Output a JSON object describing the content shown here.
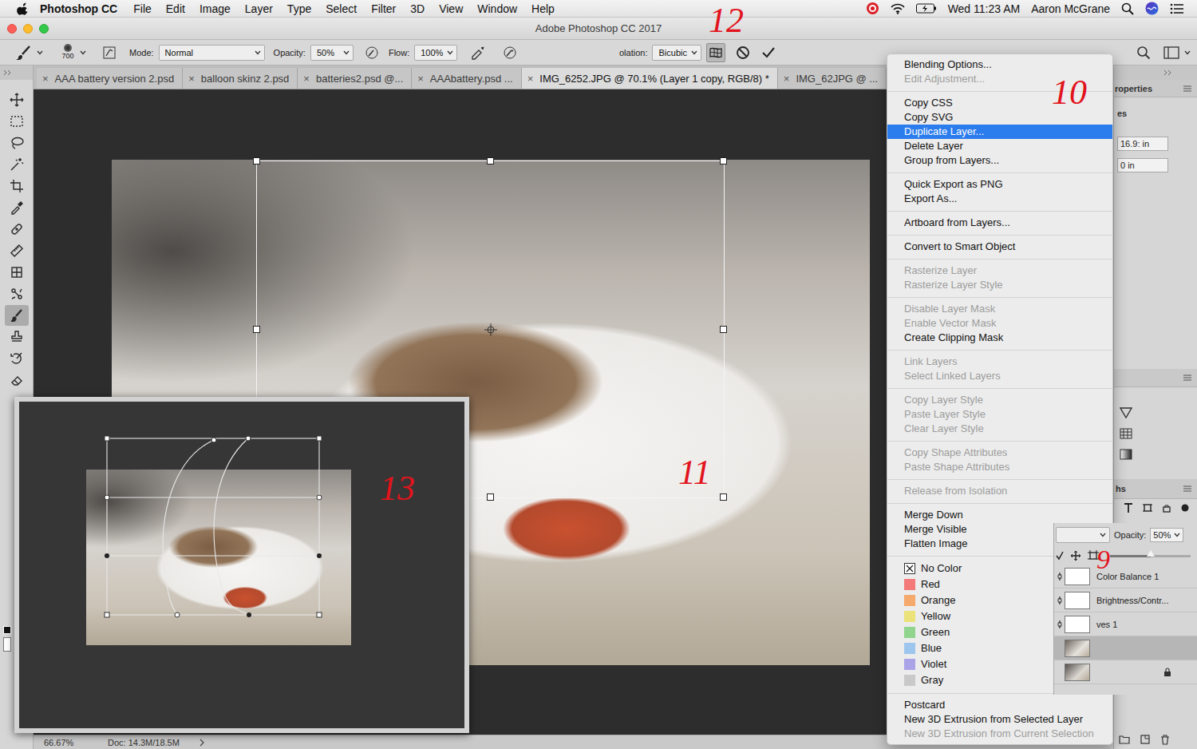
{
  "menubar": {
    "app": "Photoshop CC",
    "menus": [
      "File",
      "Edit",
      "Image",
      "Layer",
      "Type",
      "Select",
      "Filter",
      "3D",
      "View",
      "Window",
      "Help"
    ],
    "clock": "Wed 11:23 AM",
    "user": "Aaron McGrane"
  },
  "window": {
    "title": "Adobe Photoshop CC 2017"
  },
  "options_bar": {
    "brush_size": "700",
    "mode_label": "Mode:",
    "mode": "Normal",
    "opacity_label": "Opacity:",
    "opacity": "50%",
    "flow_label": "Flow:",
    "flow": "100%",
    "interpolation_label": "olation:",
    "interpolation": "Bicubic",
    "warp_active": true
  },
  "tab_close": "×",
  "tabs": [
    {
      "label": "AAA battery version 2.psd",
      "selected": false
    },
    {
      "label": "balloon skinz 2.psd",
      "selected": false
    },
    {
      "label": "batteries2.psd @...",
      "selected": false
    },
    {
      "label": "AAAbattery.psd ...",
      "selected": false
    },
    {
      "label": "IMG_6252.JPG @ 70.1% (Layer 1 copy, RGB/8) *",
      "selected": true
    },
    {
      "label": "IMG_62JPG @ ...",
      "selected": false
    }
  ],
  "tools": [
    {
      "selected": false
    },
    {
      "selected": false
    },
    {
      "selected": false
    },
    {
      "selected": false
    },
    {
      "selected": false
    },
    {
      "selected": false
    },
    {
      "selected": false
    },
    {
      "selected": false
    },
    {
      "selected": false
    },
    {
      "selected": false
    },
    {
      "selected": true
    },
    {
      "selected": false
    },
    {
      "selected": false
    },
    {
      "selected": false
    }
  ],
  "context_menu": {
    "groups": [
      [
        {
          "label": "Blending Options...",
          "kind": "item",
          "disabled": false,
          "selected": false
        },
        {
          "label": "Edit Adjustment...",
          "kind": "item",
          "disabled": true,
          "selected": false
        }
      ],
      [
        {
          "label": "Copy CSS",
          "kind": "item",
          "disabled": false,
          "selected": false
        },
        {
          "label": "Copy SVG",
          "kind": "item",
          "disabled": false,
          "selected": false
        },
        {
          "label": "Duplicate Layer...",
          "kind": "item",
          "disabled": false,
          "selected": true
        },
        {
          "label": "Delete Layer",
          "kind": "item",
          "disabled": false,
          "selected": false
        },
        {
          "label": "Group from Layers...",
          "kind": "item",
          "disabled": false,
          "selected": false
        }
      ],
      [
        {
          "label": "Quick Export as PNG",
          "kind": "item",
          "disabled": false,
          "selected": false
        },
        {
          "label": "Export As...",
          "kind": "item",
          "disabled": false,
          "selected": false
        }
      ],
      [
        {
          "label": "Artboard from Layers...",
          "kind": "item",
          "disabled": false,
          "selected": false
        }
      ],
      [
        {
          "label": "Convert to Smart Object",
          "kind": "item",
          "disabled": false,
          "selected": false
        }
      ],
      [
        {
          "label": "Rasterize Layer",
          "kind": "item",
          "disabled": true,
          "selected": false
        },
        {
          "label": "Rasterize Layer Style",
          "kind": "item",
          "disabled": true,
          "selected": false
        }
      ],
      [
        {
          "label": "Disable Layer Mask",
          "kind": "item",
          "disabled": true,
          "selected": false
        },
        {
          "label": "Enable Vector Mask",
          "kind": "item",
          "disabled": true,
          "selected": false
        },
        {
          "label": "Create Clipping Mask",
          "kind": "item",
          "disabled": false,
          "selected": false
        }
      ],
      [
        {
          "label": "Link Layers",
          "kind": "item",
          "disabled": true,
          "selected": false
        },
        {
          "label": "Select Linked Layers",
          "kind": "item",
          "disabled": true,
          "selected": false
        }
      ],
      [
        {
          "label": "Copy Layer Style",
          "kind": "item",
          "disabled": true,
          "selected": false
        },
        {
          "label": "Paste Layer Style",
          "kind": "item",
          "disabled": true,
          "selected": false
        },
        {
          "label": "Clear Layer Style",
          "kind": "item",
          "disabled": true,
          "selected": false
        }
      ],
      [
        {
          "label": "Copy Shape Attributes",
          "kind": "item",
          "disabled": true,
          "selected": false
        },
        {
          "label": "Paste Shape Attributes",
          "kind": "item",
          "disabled": true,
          "selected": false
        }
      ],
      [
        {
          "label": "Release from Isolation",
          "kind": "item",
          "disabled": true,
          "selected": false
        }
      ],
      [
        {
          "label": "Merge Down",
          "kind": "item",
          "disabled": false,
          "selected": false
        },
        {
          "label": "Merge Visible",
          "kind": "item",
          "disabled": false,
          "selected": false
        },
        {
          "label": "Flatten Image",
          "kind": "item",
          "disabled": false,
          "selected": false
        }
      ],
      [
        {
          "label": "No Color",
          "kind": "none",
          "disabled": false,
          "selected": false
        },
        {
          "label": "Red",
          "kind": "swatch",
          "color": "#f47a7a",
          "disabled": false,
          "selected": false
        },
        {
          "label": "Orange",
          "kind": "swatch",
          "color": "#f5a96c",
          "disabled": false,
          "selected": false
        },
        {
          "label": "Yellow",
          "kind": "swatch",
          "color": "#ebe27a",
          "disabled": false,
          "selected": false
        },
        {
          "label": "Green",
          "kind": "swatch",
          "color": "#90d48d",
          "disabled": false,
          "selected": false
        },
        {
          "label": "Blue",
          "kind": "swatch",
          "color": "#9dc6ee",
          "disabled": false,
          "selected": false
        },
        {
          "label": "Violet",
          "kind": "swatch",
          "color": "#aba3e8",
          "disabled": false,
          "selected": false
        },
        {
          "label": "Gray",
          "kind": "swatch",
          "color": "#c9c9c9",
          "disabled": false,
          "selected": false
        }
      ],
      [
        {
          "label": "Postcard",
          "kind": "item",
          "disabled": false,
          "selected": false
        },
        {
          "label": "New 3D Extrusion from Selected Layer",
          "kind": "item",
          "disabled": false,
          "selected": false
        },
        {
          "label": "New 3D Extrusion from Current Selection",
          "kind": "item",
          "disabled": true,
          "selected": false
        }
      ]
    ]
  },
  "properties_panel": {
    "title": "roperties",
    "subtitle": "es",
    "fields": [
      "16.9: in",
      "0 in"
    ]
  },
  "paths_panel": {
    "title": "hs"
  },
  "layers_panel": {
    "opacity_label": "Opacity:",
    "opacity": "50%",
    "opacity_level": 0.5,
    "layers": [
      {
        "name": "Color Balance 1",
        "kind": "adjustment",
        "selected": false
      },
      {
        "name": "Brightness/Contr...",
        "kind": "adjustment",
        "selected": false
      },
      {
        "name": "ves 1",
        "kind": "adjustment",
        "selected": false
      },
      {
        "kind": "pixel",
        "selected": true
      },
      {
        "kind": "background",
        "selected": false
      }
    ]
  },
  "status_bar": {
    "zoom": "66.67%",
    "doc": "Doc: 14.3M/18.5M"
  },
  "annotations": [
    {
      "text": "12"
    },
    {
      "text": "10"
    },
    {
      "text": "11"
    },
    {
      "text": "13"
    },
    {
      "text": "9"
    }
  ]
}
